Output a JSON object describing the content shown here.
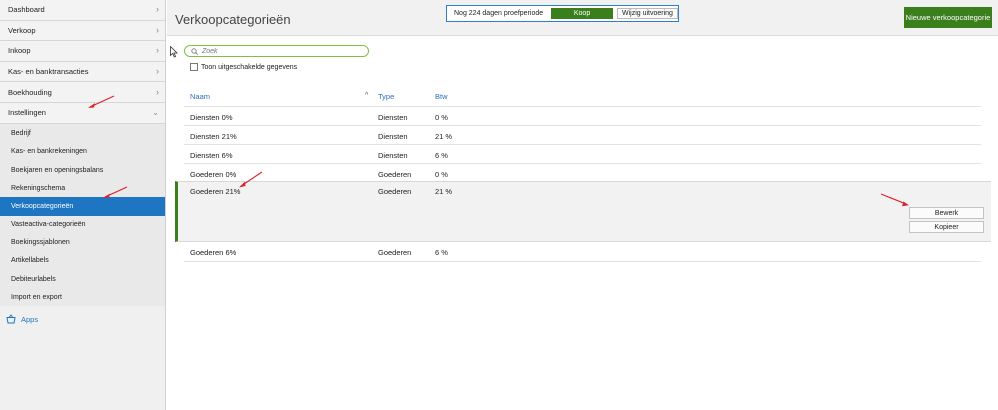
{
  "sidebar": {
    "items": [
      {
        "label": "Dashboard"
      },
      {
        "label": "Verkoop"
      },
      {
        "label": "Inkoop"
      },
      {
        "label": "Kas- en banktransacties"
      },
      {
        "label": "Boekhouding"
      },
      {
        "label": "Instellingen"
      }
    ],
    "settings_items": [
      {
        "label": "Bedrijf"
      },
      {
        "label": "Kas- en bankrekeningen"
      },
      {
        "label": "Boekjaren en openingsbalans"
      },
      {
        "label": "Rekeningschema"
      },
      {
        "label": "Verkoopcategorieën"
      },
      {
        "label": "Vasteactiva-categorieën"
      },
      {
        "label": "Boekingssjablonen"
      },
      {
        "label": "Artikellabels"
      },
      {
        "label": "Debiteurlabels"
      },
      {
        "label": "Import en export"
      }
    ],
    "active_item": "Verkoopcategorieën",
    "apps_label": "Apps"
  },
  "header": {
    "title": "Verkoopcategorieën",
    "trial_text": "Nog 224 dagen proefperiode",
    "buy_label": "Koop",
    "change_label": "Wijzig uitvoering",
    "new_button_label": "Nieuwe verkoopcategorie"
  },
  "search": {
    "placeholder": "Zoek",
    "value": ""
  },
  "show_disabled_label": "Toon uitgeschakelde gegevens",
  "table": {
    "columns": [
      "Naam",
      "Type",
      "Btw"
    ],
    "rows": [
      {
        "name": "Diensten 0%",
        "type": "Diensten",
        "vat": "0 %"
      },
      {
        "name": "Diensten 21%",
        "type": "Diensten",
        "vat": "21 %"
      },
      {
        "name": "Diensten 6%",
        "type": "Diensten",
        "vat": "6 %"
      },
      {
        "name": "Goederen 0%",
        "type": "Goederen",
        "vat": "0 %"
      },
      {
        "name": "Goederen 21%",
        "type": "Goederen",
        "vat": "21 %"
      },
      {
        "name": "Goederen 6%",
        "type": "Goederen",
        "vat": "6 %"
      }
    ],
    "expanded_row_index": 4,
    "edit_label": "Bewerk",
    "copy_label": "Kopieer"
  },
  "colors": {
    "accent_blue": "#1e76c2",
    "green": "#3b7e1c",
    "annotation_arrow": "#d9262c"
  }
}
